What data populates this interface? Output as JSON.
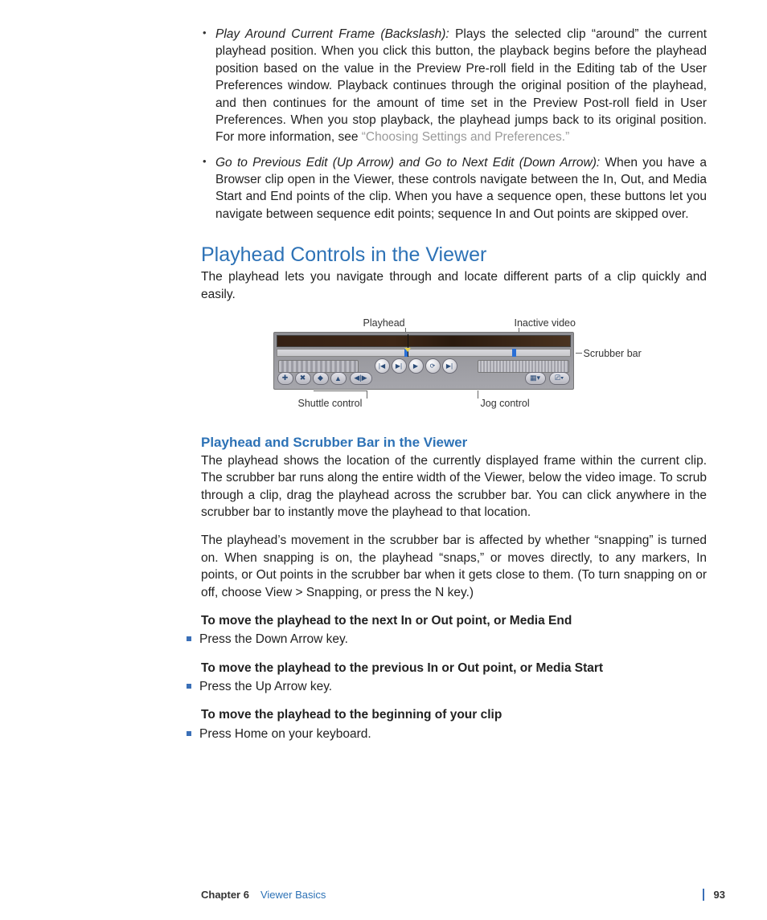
{
  "bullets": [
    {
      "term": "Play Around Current Frame (Backslash):",
      "body": "  Plays the selected clip “around” the current playhead position. When you click this button, the playback begins before the playhead position based on the value in the Preview Pre-roll field in the Editing tab of the User Preferences window. Playback continues through the original position of the playhead, and then continues for the amount of time set in the Preview Post-roll field in User Preferences. When you stop playback, the playhead jumps back to its original position. For more information, see ",
      "link": "“Choosing Settings and Preferences.”"
    },
    {
      "term": "Go to Previous Edit (Up Arrow) and Go to Next Edit (Down Arrow):",
      "body": "  When you have a Browser clip open in the Viewer, these controls navigate between the In, Out, and Media Start and End points of the clip. When you have a sequence open, these buttons let you navigate between sequence edit points; sequence In and Out points are skipped over.",
      "link": ""
    }
  ],
  "heading": "Playhead Controls in the Viewer",
  "intro": "The playhead lets you navigate through and locate different parts of a clip quickly and easily.",
  "labels": {
    "playhead": "Playhead",
    "inactive": "Inactive video",
    "scrubber": "Scrubber bar",
    "shuttle": "Shuttle control",
    "jog": "Jog control"
  },
  "subheading": "Playhead and Scrubber Bar in the Viewer",
  "para1": "The playhead shows the location of the currently displayed frame within the current clip. The scrubber bar runs along the entire width of the Viewer, below the video image. To scrub through a clip, drag the playhead across the scrubber bar. You can click anywhere in the scrubber bar to instantly move the playhead to that location.",
  "para2": "The playhead’s movement in the scrubber bar is affected by whether “snapping” is turned on. When snapping is on, the playhead “snaps,” or moves directly, to any markers, In points, or Out points in the scrubber bar when it gets close to them. (To turn snapping on or off, choose View > Snapping, or press the N key.)",
  "lead1": "To move the playhead to the next In or Out point, or Media End",
  "step1": "Press the Down Arrow key.",
  "lead2": "To move the playhead to the previous In or Out point, or Media Start",
  "step2": "Press the Up Arrow key.",
  "lead3": "To move the playhead to the beginning of your clip",
  "step3": "Press Home on your keyboard.",
  "footer": {
    "chapter": "Chapter 6",
    "title": "Viewer Basics",
    "page": "93"
  }
}
